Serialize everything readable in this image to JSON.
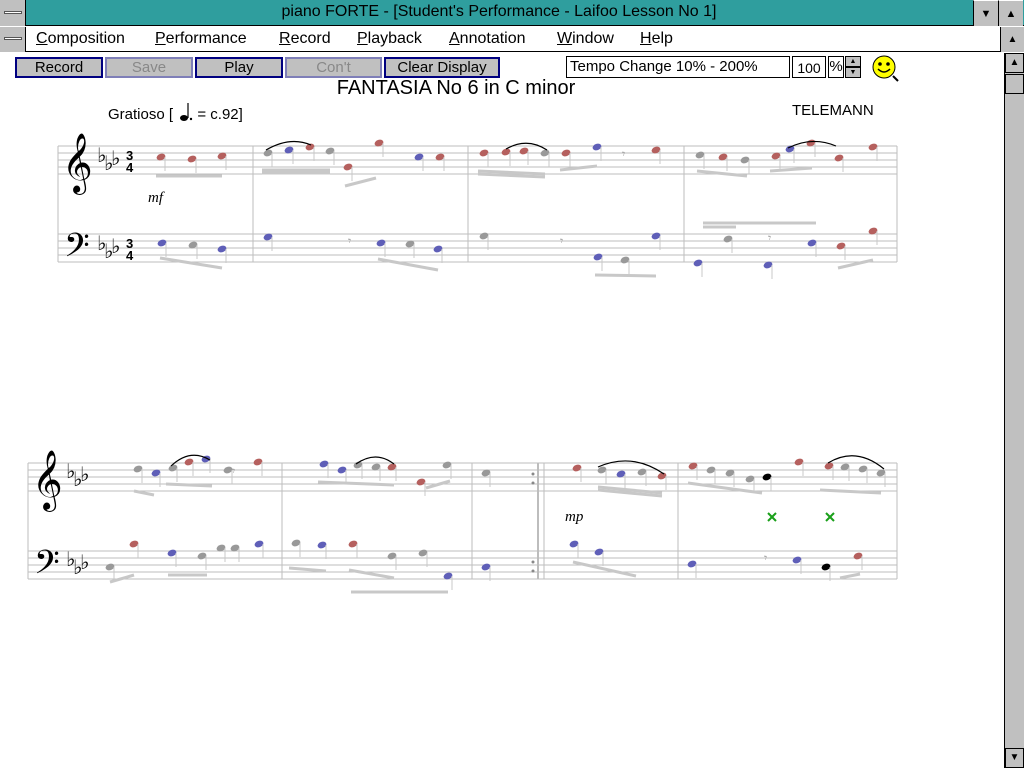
{
  "window": {
    "title": "piano FORTE - [Student's Performance - Laifoo Lesson No 1]"
  },
  "menu": [
    {
      "label": "Composition",
      "key": "C",
      "rest": "omposition"
    },
    {
      "label": "Performance",
      "key": "P",
      "rest": "erformance"
    },
    {
      "label": "Record",
      "key": "R",
      "rest": "ecord"
    },
    {
      "label": "Playback",
      "key": "P",
      "rest": "layback"
    },
    {
      "label": "Annotation",
      "key": "A",
      "rest": "nnotation"
    },
    {
      "label": "Window",
      "key": "W",
      "rest": "indow"
    },
    {
      "label": "Help",
      "key": "H",
      "rest": "elp"
    }
  ],
  "toolbar": {
    "record": "Record",
    "save": "Save",
    "play": "Play",
    "cont": "Con't",
    "clear": "Clear Display",
    "tempo_label": "Tempo Change 10% - 200%",
    "tempo_value": "100",
    "percent": "%"
  },
  "score": {
    "title": "FANTASIA No 6 in C minor",
    "tempo_mark": "Gratioso [",
    "tempo_value": "= c.92]",
    "composer": "TELEMANN",
    "time_sig": {
      "top": "3",
      "bottom": "4"
    },
    "dynamics": {
      "first": "mf",
      "second": "mp"
    }
  },
  "colors": {
    "title_bar": "#2f9e9e",
    "red_note": "#b5605e",
    "blue_note": "#5f5fb8",
    "gray_note": "#999999",
    "green_mark": "#1aa01a",
    "toolbar_border": "#000080"
  }
}
